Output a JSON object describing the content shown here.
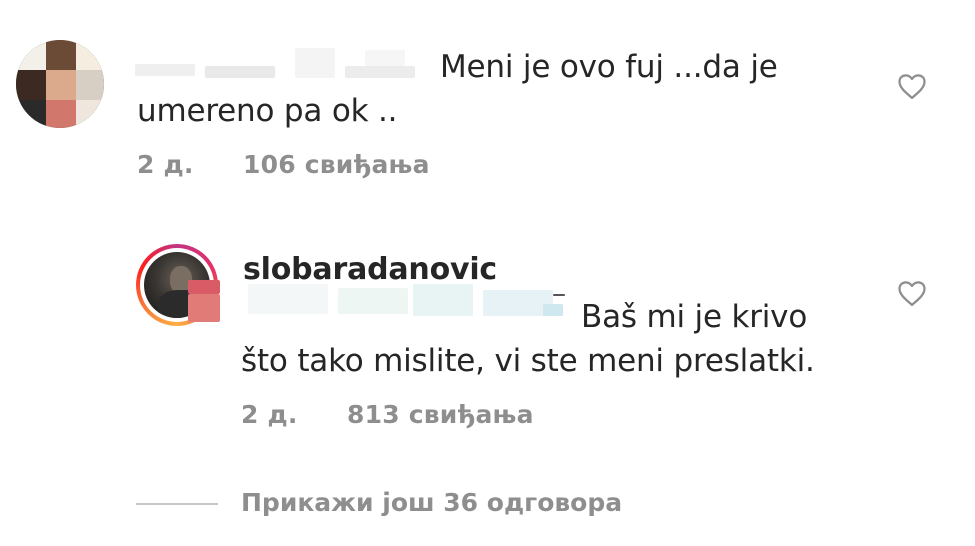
{
  "comment": {
    "text_line1": "Meni je ovo fuj ...da je",
    "text_line2": "umereno pa ok ..",
    "time": "2 д.",
    "likes": "106 свиђања",
    "like_icon": "heart-outline-icon"
  },
  "reply": {
    "username": "slobaradanovic",
    "text_line1": "Baš mi je krivo",
    "text_line2": "što tako mislite, vi ste meni preslatki.",
    "time": "2 д.",
    "likes": "813 свиђања",
    "like_icon": "heart-outline-icon"
  },
  "more_replies": "Прикажи још 36 одговора",
  "colors": {
    "text": "#262626",
    "meta": "#8e8e8e",
    "divider": "#c7c7c7",
    "story_ring": [
      "#c13584",
      "#e1306c",
      "#f56040",
      "#fcaf45"
    ]
  }
}
